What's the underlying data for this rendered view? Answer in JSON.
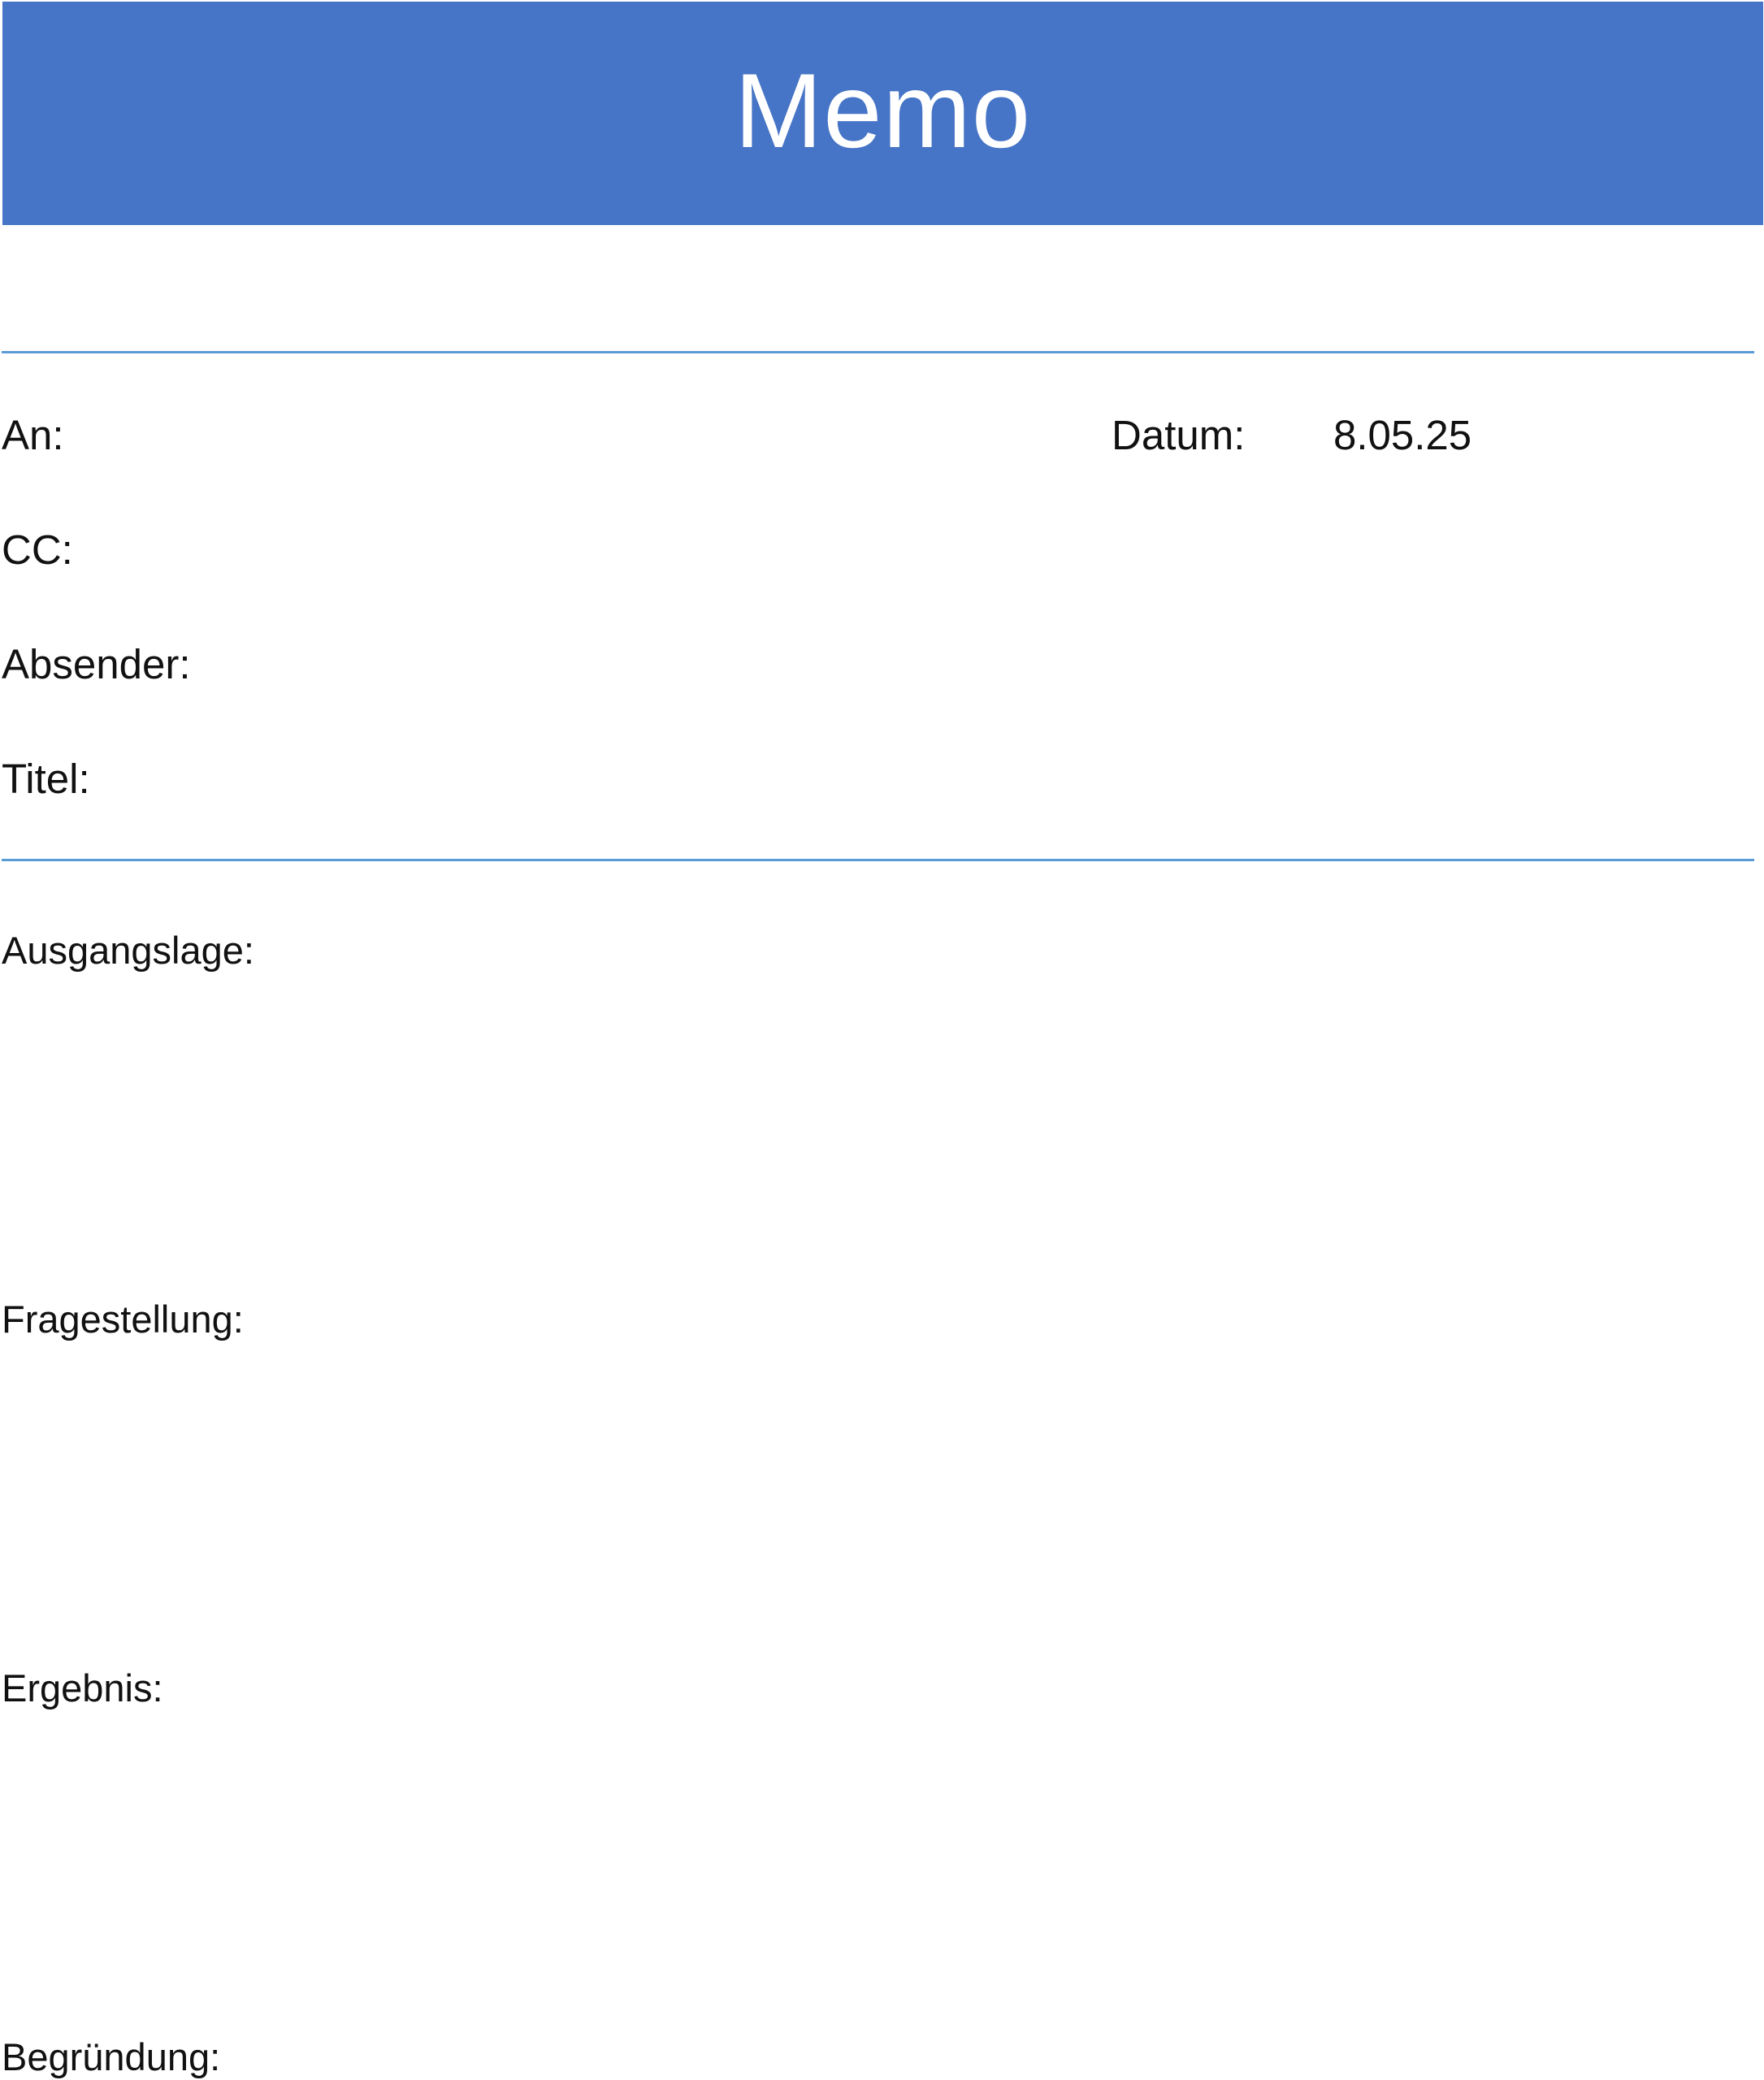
{
  "header": {
    "title": "Memo",
    "background_color": "#4674c6",
    "text_color": "#ffffff"
  },
  "rule_color": "#5b9bd5",
  "fields": {
    "an_label": "An:",
    "cc_label": "CC:",
    "absender_label": "Absender:",
    "titel_label": "Titel:",
    "datum_label": "Datum:",
    "datum_value": "8.05.25"
  },
  "sections": {
    "ausgangslage": "Ausgangslage:",
    "fragestellung": "Fragestellung:",
    "ergebnis": "Ergebnis:",
    "begruendung": "Begründung:"
  }
}
